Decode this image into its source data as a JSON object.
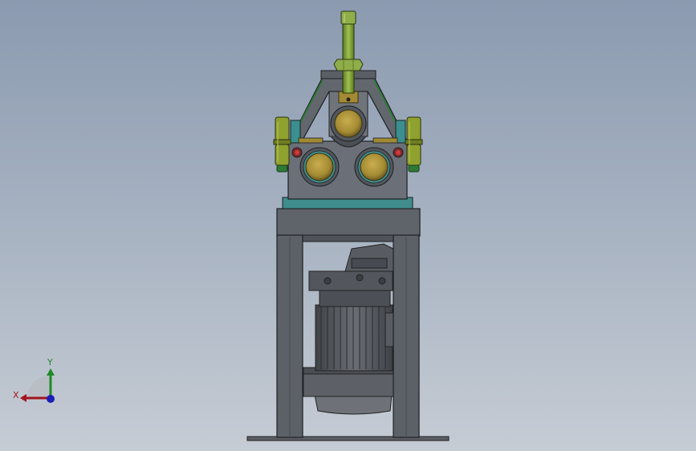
{
  "viewport": {
    "background_top": "#8b9ab0",
    "background_bottom": "#c6ccd4"
  },
  "triad": {
    "x_label": "X",
    "y_label": "Y",
    "x_color": "#a3141c",
    "y_color": "#1f8a2a",
    "z_color": "#1b1fb5"
  },
  "model": {
    "frame_color": "#5c6168",
    "housing_color": "#6b7078",
    "base_plate_color": "#3f8d8c",
    "roller_color": "#a48b33",
    "shaft_color": "#8fae4a",
    "cylinder_color": "#8fa12e",
    "motor_color": "#5d6066"
  }
}
